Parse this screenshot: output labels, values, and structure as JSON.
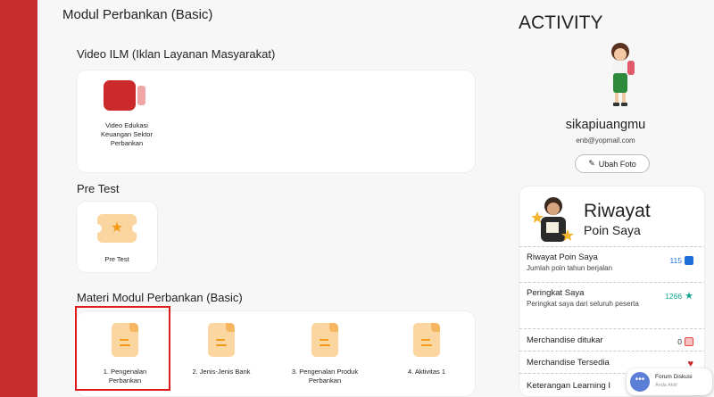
{
  "module": {
    "title": "Modul Perbankan (Basic)"
  },
  "sections": {
    "video": {
      "title": "Video ILM (Iklan Layanan Masyarakat)",
      "items": [
        {
          "label": "Video Edukasi Keuangan Sektor Perbankan",
          "icon": "video-camera-icon"
        }
      ]
    },
    "pretest": {
      "title": "Pre Test",
      "items": [
        {
          "label": "Pre Test",
          "icon": "star-ticket-icon"
        }
      ]
    },
    "materi": {
      "title": "Materi Modul Perbankan (Basic)",
      "items": [
        {
          "label": "1. Pengenalan Perbankan",
          "icon": "document-icon"
        },
        {
          "label": "2. Jenis-Jenis Bank",
          "icon": "document-icon"
        },
        {
          "label": "3. Pengenalan Produk Perbankan",
          "icon": "document-icon"
        },
        {
          "label": "4. Aktivitas 1",
          "icon": "document-icon"
        }
      ]
    }
  },
  "activity": {
    "title": "ACTIVITY",
    "username": "sikapiuangmu",
    "email": "enb@yopmail.com",
    "change_photo_label": "Ubah Foto",
    "points": {
      "title": "Riwayat",
      "subtitle": "Poin Saya",
      "rows": [
        {
          "label": "Riwayat Poin Saya",
          "desc": "Jumlah poin tahun berjalan",
          "value": "115",
          "icon": "chart-icon",
          "color": "#1f6fd6"
        },
        {
          "label": "Peringkat Saya",
          "desc": "Peringkat saya dari seluruh peserta",
          "value": "1266",
          "icon": "trophy-icon",
          "color": "#0fa38f"
        },
        {
          "label": "Merchandise ditukar",
          "desc": "",
          "value": "0",
          "icon": "gift-icon",
          "color": "#e24545"
        },
        {
          "label": "Merchandise Tersedia",
          "desc": "",
          "value": "",
          "icon": "heart-icon",
          "color": "#c62d2d"
        },
        {
          "label": "Keterangan Learning I",
          "desc": "",
          "value": "",
          "icon": "",
          "color": ""
        }
      ]
    }
  },
  "forum": {
    "title": "Forum Diskusi",
    "subtitle": "Anda Aktif"
  },
  "colors": {
    "brand_red": "#c62d2d",
    "accent_orange": "#f39b18",
    "highlight": "#e01b1b"
  }
}
